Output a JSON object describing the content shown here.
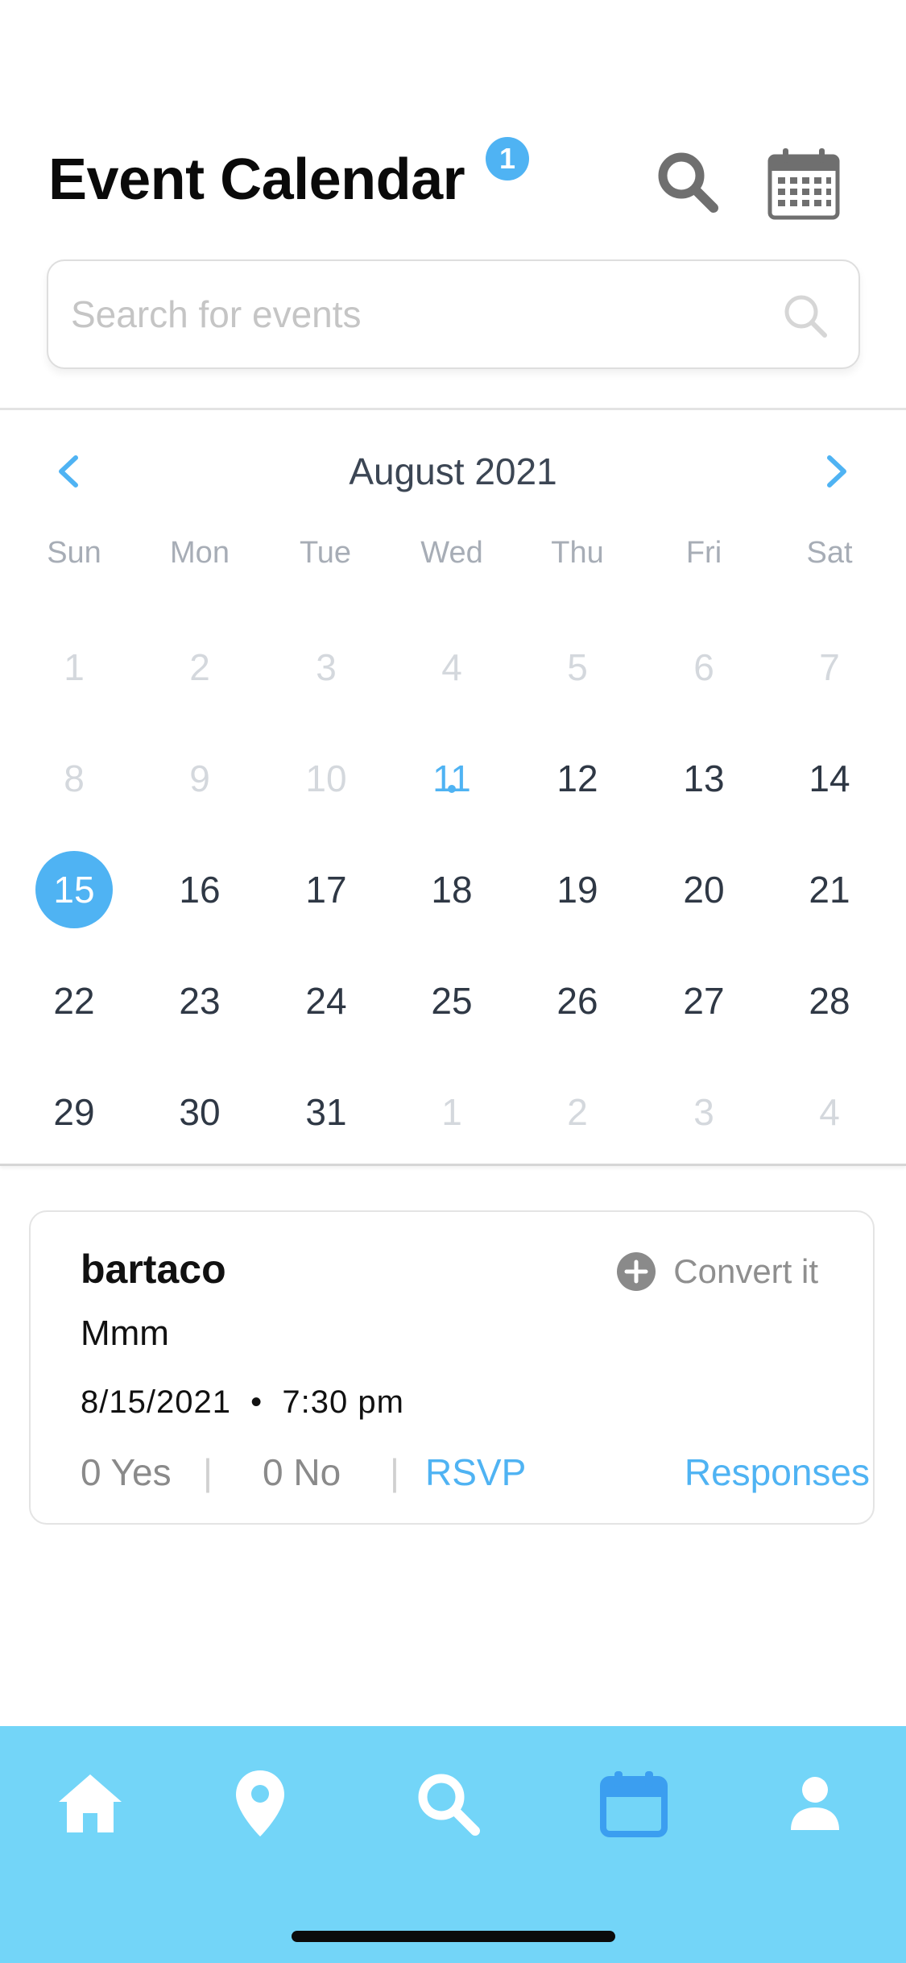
{
  "header": {
    "title": "Event Calendar",
    "badge_count": "1"
  },
  "search": {
    "placeholder": "Search for events",
    "value": ""
  },
  "calendar": {
    "month_label": "August 2021",
    "weekdays": [
      "Sun",
      "Mon",
      "Tue",
      "Wed",
      "Thu",
      "Fri",
      "Sat"
    ],
    "weeks": [
      [
        "1",
        "2",
        "3",
        "4",
        "5",
        "6",
        "7"
      ],
      [
        "8",
        "9",
        "10",
        "11",
        "12",
        "13",
        "14"
      ],
      [
        "15",
        "16",
        "17",
        "18",
        "19",
        "20",
        "21"
      ],
      [
        "22",
        "23",
        "24",
        "25",
        "26",
        "27",
        "28"
      ],
      [
        "29",
        "30",
        "31",
        "1",
        "2",
        "3",
        "4"
      ]
    ],
    "selected_day": "15",
    "today_day": "11",
    "event_days": [
      "11"
    ]
  },
  "event": {
    "title": "bartaco",
    "convert_label": "Convert it",
    "description": "Mmm",
    "date": "8/15/2021",
    "time": "7:30 pm",
    "yes_label": "0 Yes",
    "no_label": "0 No",
    "rsvp_label": "RSVP",
    "responses_label": "Responses"
  },
  "tabs": [
    {
      "name": "home",
      "icon": "home-icon",
      "active": false
    },
    {
      "name": "map",
      "icon": "map-pin-icon",
      "active": false
    },
    {
      "name": "search",
      "icon": "search-icon",
      "active": false
    },
    {
      "name": "calendar",
      "icon": "calendar-icon",
      "active": true
    },
    {
      "name": "profile",
      "icon": "user-icon",
      "active": false
    }
  ],
  "colors": {
    "accent": "#4fb3f3",
    "tabbar": "#73d5f8",
    "tab_active": "#3b9ef0",
    "tab_inactive": "#ffffff"
  }
}
